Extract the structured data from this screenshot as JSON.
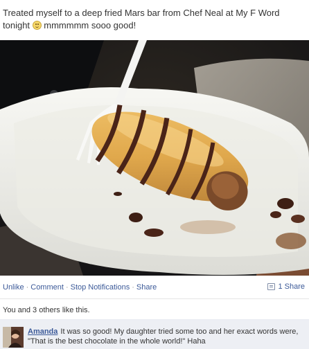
{
  "post": {
    "text_before": "Treated myself to a deep fried Mars bar from ",
    "chef_name": "Chef Neal",
    "text_middle": " at My F Word tonight ",
    "text_after": " mmmmmm sooo good!"
  },
  "photo": {
    "icon": "photo-deep-fried-mars-bar"
  },
  "actions": {
    "unlike": "Unlike",
    "comment": "Comment",
    "stop_notifications": "Stop Notifications",
    "share": "Share",
    "separator": "·",
    "share_count": "1 Share"
  },
  "likes": {
    "text": "You and 3 others like this."
  },
  "comment": {
    "author": "Amanda",
    "text": "It was so good! My daughter tried some too and her exact words were, \"That is the best chocolate in the whole world!\"  Haha"
  },
  "colors": {
    "link": "#3b5998",
    "comment_bg": "#edeff4",
    "text": "#333333"
  }
}
